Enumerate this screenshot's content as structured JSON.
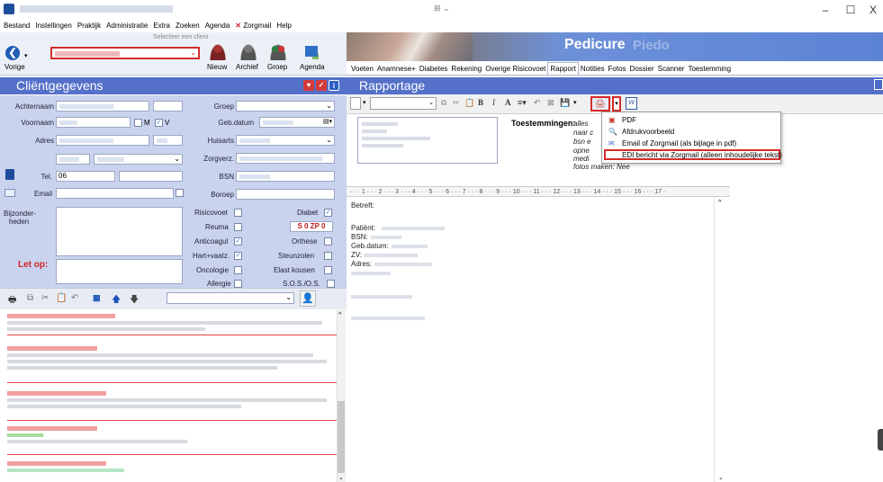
{
  "window": {
    "minimize": "–",
    "maximize": "☐",
    "close": "X",
    "center_widget": "⊞ ⌄"
  },
  "menu": {
    "items": [
      "Bestand",
      "Instellingen",
      "Praktijk",
      "Administratie",
      "Extra",
      "Zoeken",
      "Agenda",
      "Zorgmail",
      "Help"
    ],
    "zorgmail_glyph": "✕"
  },
  "toolbar": {
    "select_hint": "Selecteer een client",
    "back_label": "Vorige",
    "back_glyph": "❮",
    "new_label": "Nieuw",
    "archive_label": "Archief",
    "group_label": "Groep",
    "agenda_label": "Agenda"
  },
  "client_panel": {
    "title": "Cliëntgegevens",
    "fields": {
      "achternaam": "Achternaam",
      "voornaam": "Voornaam",
      "adres": "Adres",
      "tel": "Tel.",
      "tel_value": "06",
      "email": "Email",
      "bijzonderheden_1": "Bijzonder-",
      "bijzonderheden_2": "heden",
      "let_op": "Let op:",
      "groep": "Groep",
      "geb_datum": "Geb.datum",
      "huisarts": "Huisarts",
      "zorgverz": "Zorgverz.",
      "bsn": "BSN",
      "boroep": "Boroep",
      "m_label": "M",
      "v_label": "V"
    },
    "checks": {
      "risicovoet": "Risicovoet",
      "reuma": "Reuma",
      "anticoagul": "Anticoagul",
      "hart_vaatz": "Hart+vaatz.",
      "oncologie": "Oncologie",
      "allergie": "Allergie",
      "diabet": "Diabet",
      "sozp": "S 0 ZP 0",
      "orthese": "Orthese",
      "steunzolen": "Steunzolen",
      "elast_kousen": "Elast kousen",
      "sos": "S.O.S./O.S."
    },
    "check_mark": "✓"
  },
  "right_panel": {
    "brand": "Pedicure",
    "brand_ghost": "Piedo",
    "tabs": [
      "Voeten",
      "Anamnese+",
      "Diabetes",
      "Rekening",
      "Overige Risicovoet",
      "Rapport",
      "Notities",
      "Fotos",
      "Dossier",
      "Scanner",
      "Toestemming"
    ],
    "active_tab": "Rapport",
    "section_title": "Rapportage",
    "toolbar_glyphs": {
      "bold": "B",
      "italic": "I",
      "font": "A",
      "w_icon": "W"
    },
    "toestemmingen_label": "Toestemmingen:",
    "toestemmingen_lines": [
      "alles",
      "naar c",
      "bsn e",
      "opne",
      "medi",
      "fotos maken: Nee"
    ],
    "dropdown": {
      "items": [
        {
          "label": "PDF"
        },
        {
          "label": "Afdrukvoorbeeld"
        },
        {
          "label": "Email of Zorgmail (als bijlage in pdf)"
        },
        {
          "label": "EDI bericht via Zorgmail (alleen inhoudelijke tekst)"
        }
      ]
    },
    "ruler": "· · · 1 · · · 2 · · · 3 · · · 4 · · · 5 · · · 6 · · · 7 · · · 8 · · · 9 · · · 10 · · · 11 · · · 12 · · · 13 · · · 14 · · · 15 · · · 16 · · · 17 ·",
    "document": {
      "betreft": "Betreft:",
      "patient": "Patiënt:",
      "bsn": "BSN:",
      "geb_datum": "Geb.datum:",
      "zv": "ZV:",
      "adres": "Adres:"
    }
  }
}
